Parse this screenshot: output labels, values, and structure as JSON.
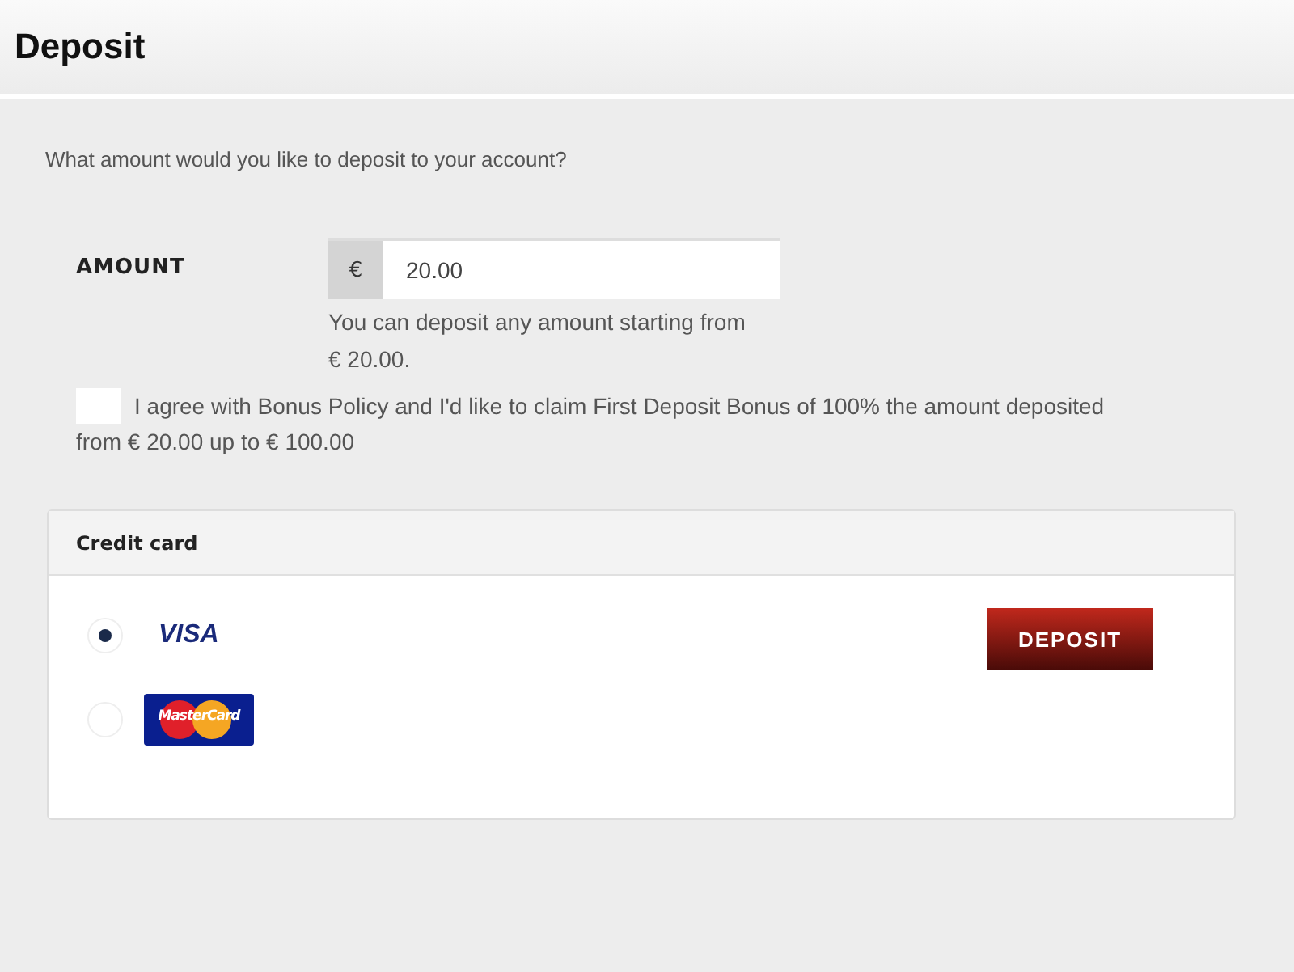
{
  "title": "Deposit",
  "question": "What amount would you like to deposit to your account?",
  "amount": {
    "label": "AMOUNT",
    "currency": "€",
    "value": "20.00",
    "hint": "You can deposit any amount starting from € 20.00."
  },
  "bonus": {
    "checked": false,
    "text": "I agree with Bonus Policy and I'd like to claim First Deposit Bonus of 100% the amount deposited from € 20.00 up to € 100.00"
  },
  "payment": {
    "title": "Credit card",
    "methods": [
      {
        "kind": "visa",
        "label": "VISA",
        "selected": true
      },
      {
        "kind": "mastercard",
        "label": "MasterCard",
        "selected": false
      }
    ],
    "button": "DEPOSIT"
  }
}
